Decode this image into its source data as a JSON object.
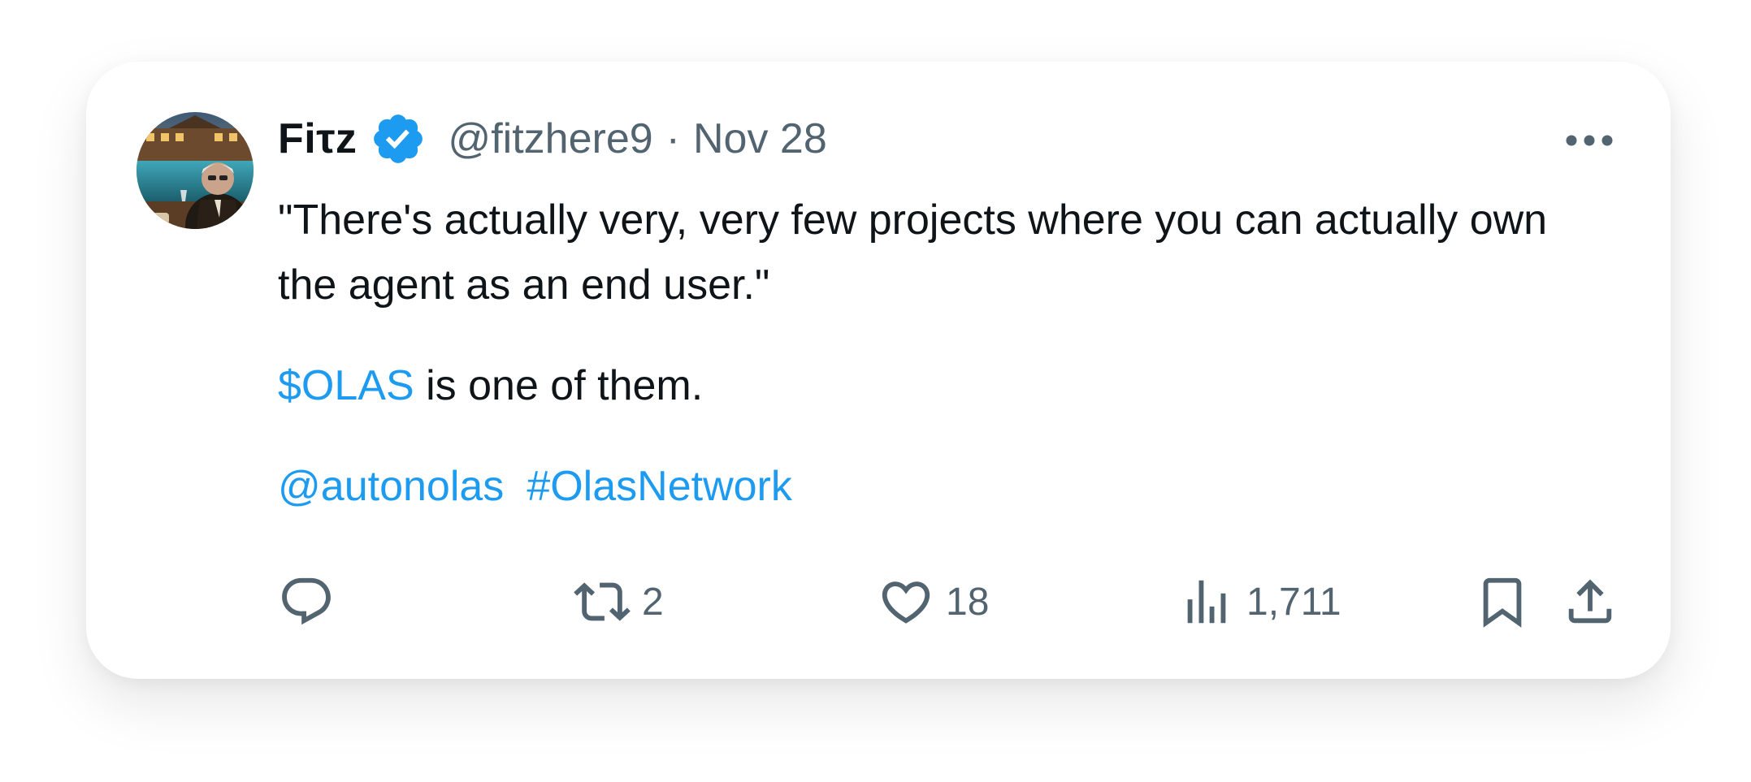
{
  "tweet": {
    "author": {
      "name": "Fiτz",
      "handle": "@fitzhere9",
      "verified": true,
      "avatar": "avatar-image"
    },
    "separator": "·",
    "date": "Nov 28",
    "quote": "\"There's actually very, very few projects where you can actually own the agent as an end user.\"",
    "cashtag": "$OLAS",
    "olas_rest": " is one of them.",
    "mention": "@autonolas",
    "hashtag": "#OlasNetwork"
  },
  "actions": {
    "reply": {
      "icon": "reply-icon",
      "count": ""
    },
    "retweet": {
      "icon": "retweet-icon",
      "count": "2"
    },
    "like": {
      "icon": "heart-icon",
      "count": "18"
    },
    "views": {
      "icon": "views-icon",
      "count": "1,711"
    },
    "bookmark": {
      "icon": "bookmark-icon"
    },
    "share": {
      "icon": "share-icon"
    }
  },
  "colors": {
    "link": "#1d9bf0",
    "text": "#0f1419",
    "secondary": "#536471",
    "verified": "#1d9bf0"
  }
}
